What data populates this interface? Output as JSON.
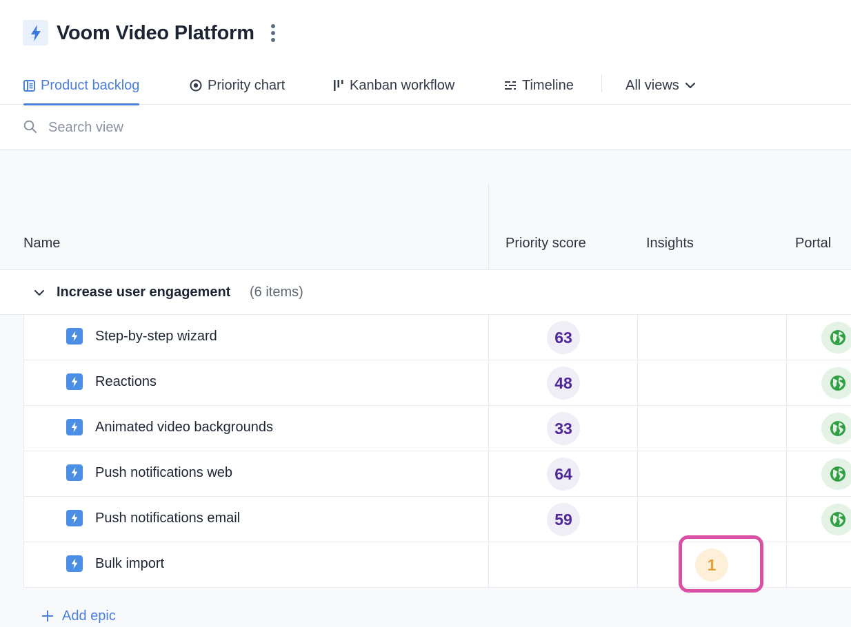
{
  "header": {
    "title": "Voom Video Platform",
    "logo_icon": "bolt-icon",
    "more_icon": "vertical-ellipsis-icon"
  },
  "tabs": [
    {
      "label": "Product backlog",
      "icon": "list-icon",
      "active": true
    },
    {
      "label": "Priority chart",
      "icon": "target-icon",
      "active": false
    },
    {
      "label": "Kanban workflow",
      "icon": "kanban-icon",
      "active": false
    },
    {
      "label": "Timeline",
      "icon": "timeline-icon",
      "active": false
    },
    {
      "label": "All views",
      "icon": "chevron-down-icon",
      "active": false
    }
  ],
  "search": {
    "placeholder": "Search view"
  },
  "columns": {
    "name": "Name",
    "priority_score": "Priority score",
    "insights": "Insights",
    "portal": "Portal"
  },
  "group": {
    "name": "Increase user engagement",
    "count": "(6 items)"
  },
  "rows": [
    {
      "name": "Step-by-step wizard",
      "score": "63",
      "insights": "",
      "portal": true
    },
    {
      "name": "Reactions",
      "score": "48",
      "insights": "",
      "portal": true
    },
    {
      "name": "Animated video backgrounds",
      "score": "33",
      "insights": "",
      "portal": true
    },
    {
      "name": "Push notifications web",
      "score": "64",
      "insights": "",
      "portal": true
    },
    {
      "name": "Push notifications email",
      "score": "59",
      "insights": "",
      "portal": true
    },
    {
      "name": "Bulk import",
      "score": "",
      "insights": "1",
      "portal": false
    }
  ],
  "footer": {
    "add_epic": "Add epic"
  },
  "colors": {
    "accent": "#4a7ed8",
    "score_text": "#4e2799",
    "score_bg": "#efedf6",
    "portal_green": "#2ea043",
    "insight_orange": "#e5a13b",
    "highlight": "#d94fa6"
  }
}
